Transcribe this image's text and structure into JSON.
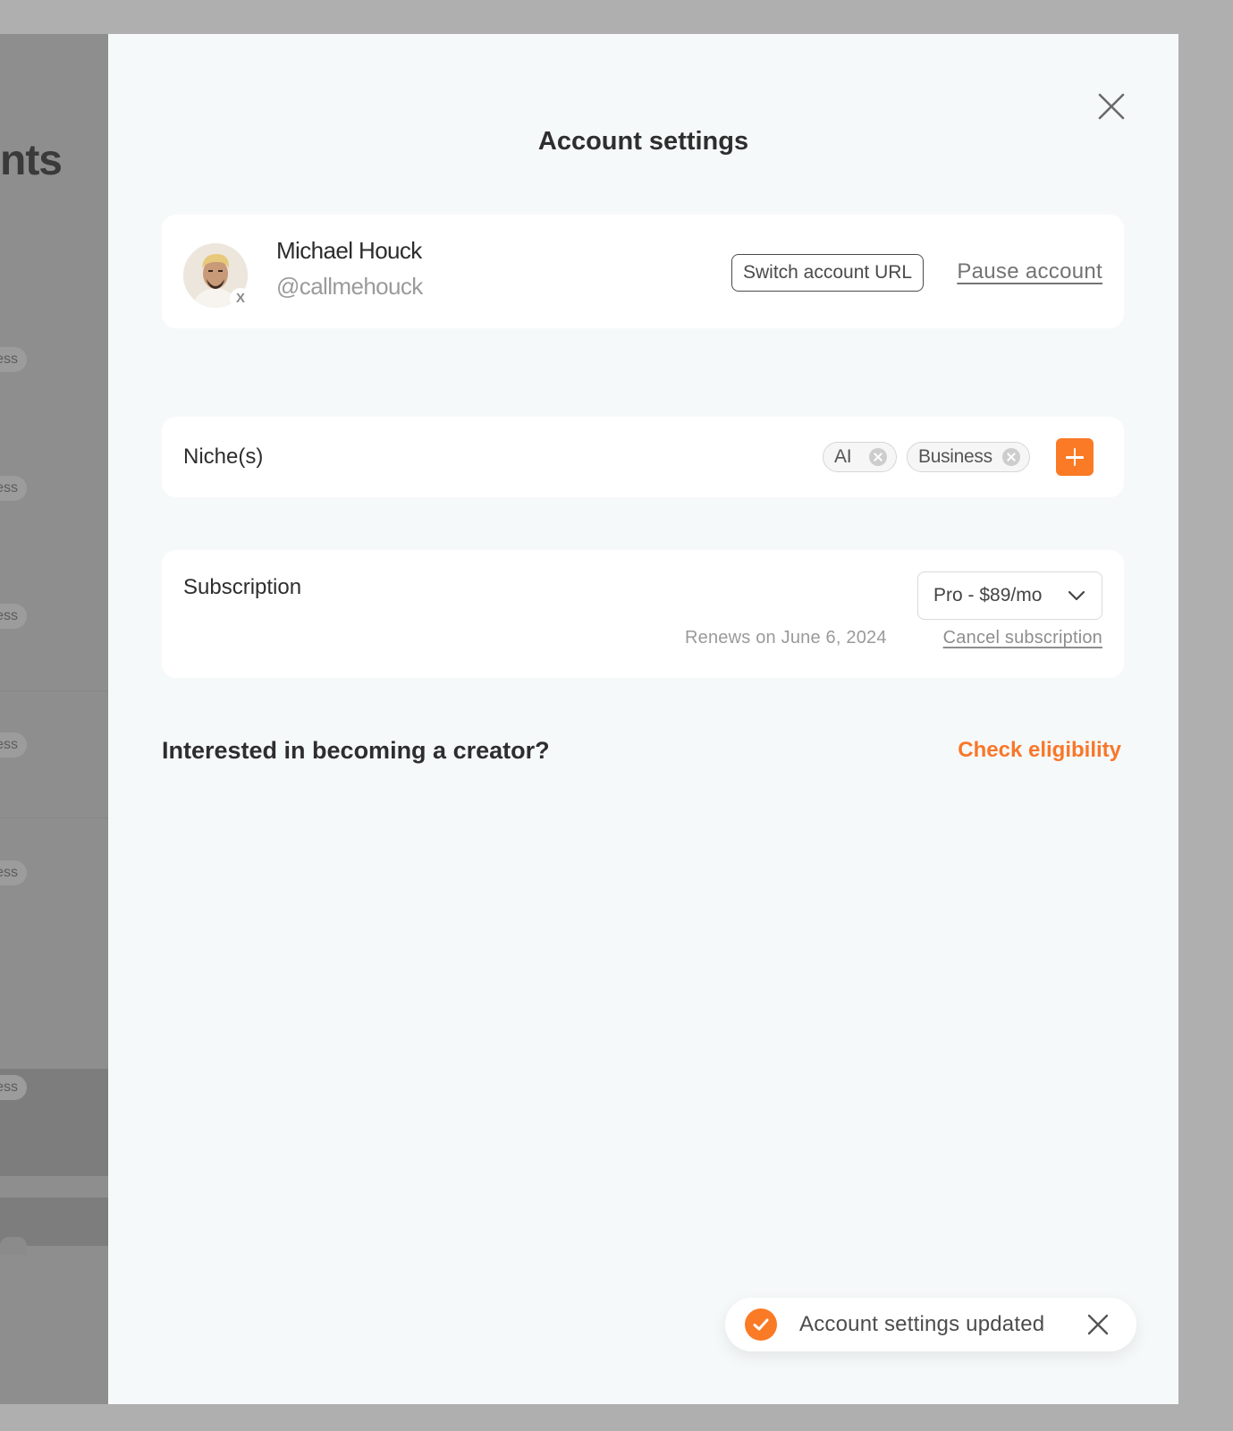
{
  "background": {
    "title_fragment": "nts",
    "pill_fragment": "ess"
  },
  "modal": {
    "title": "Account settings",
    "close_icon": "close-icon"
  },
  "profile": {
    "name": "Michael Houck",
    "handle": "@callmehouck",
    "platform_badge": "X",
    "switch_button": "Switch account URL",
    "pause_link": "Pause account"
  },
  "niches": {
    "label": "Niche(s)",
    "tags": [
      "AI",
      "Business"
    ],
    "add_icon": "plus-icon"
  },
  "subscription": {
    "label": "Subscription",
    "selected_plan": "Pro - $89/mo",
    "renews_text": "Renews on June 6, 2024",
    "cancel_link": "Cancel subscription"
  },
  "creator": {
    "question": "Interested in becoming a creator?",
    "action": "Check eligibility"
  },
  "toast": {
    "message": "Account settings updated"
  },
  "colors": {
    "accent": "#fa7a26",
    "modal_bg": "#f6f9fa",
    "card_bg": "#ffffff",
    "overlay": "#8e8e8e"
  }
}
